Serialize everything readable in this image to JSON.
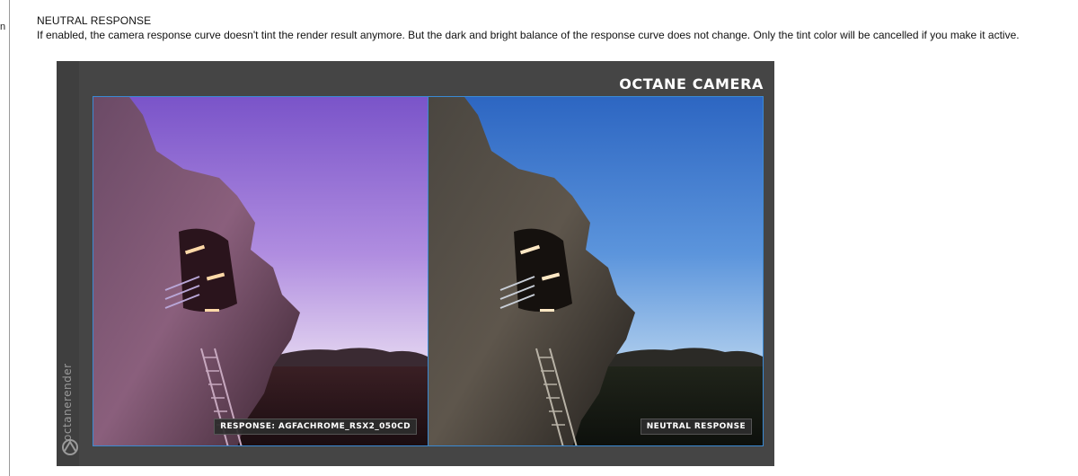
{
  "sidebar": {
    "fragment": "n"
  },
  "section": {
    "heading": "NEUTRAL RESPONSE",
    "description": "If enabled, the camera response curve doesn't tint the render result anymore. But the dark and bright balance of the response curve does not change. Only the tint color will be cancelled if you make it active."
  },
  "figure": {
    "brand": "octanerender",
    "title": "OCTANE CAMERA",
    "panels": [
      {
        "label": "RESPONSE: AGFACHROME_RSX2_050CD",
        "tint": "purple"
      },
      {
        "label": "NEUTRAL RESPONSE",
        "tint": "blue"
      }
    ],
    "colors": {
      "frame": "#454545",
      "border": "#3a8ad4",
      "sky_purple": "#9d72d8",
      "sky_blue": "#3f7fd0"
    }
  }
}
